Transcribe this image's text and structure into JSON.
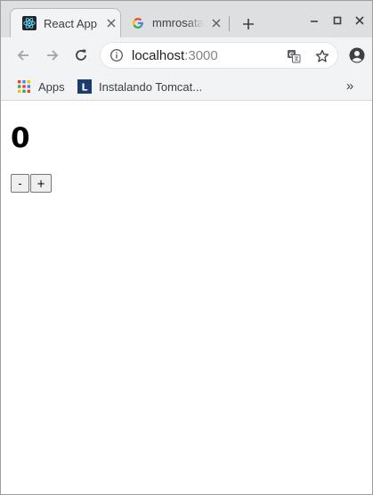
{
  "browser": {
    "tabs": [
      {
        "title": "React App",
        "active": true,
        "favicon": "react-icon"
      },
      {
        "title": "mmrosatab",
        "active": false,
        "favicon": "google-icon"
      }
    ],
    "omnibox": {
      "host": "localhost",
      "port": ":3000"
    },
    "bookmarks": [
      {
        "label": "Apps",
        "icon": "apps-grid-icon"
      },
      {
        "label": "Instalando Tomcat...",
        "icon": "bookmark-favicon-l",
        "icon_letter": "L"
      }
    ],
    "bookmarks_overflow": "»"
  },
  "page": {
    "counter": "0",
    "decrement_label": "-",
    "increment_label": "+"
  },
  "colors": {
    "tabstrip_bg": "#dedfe1",
    "toolbar_bg": "#f2f3f4",
    "react_blue": "#61dafb",
    "bookmark_icon_bg": "#1d3c6e"
  }
}
